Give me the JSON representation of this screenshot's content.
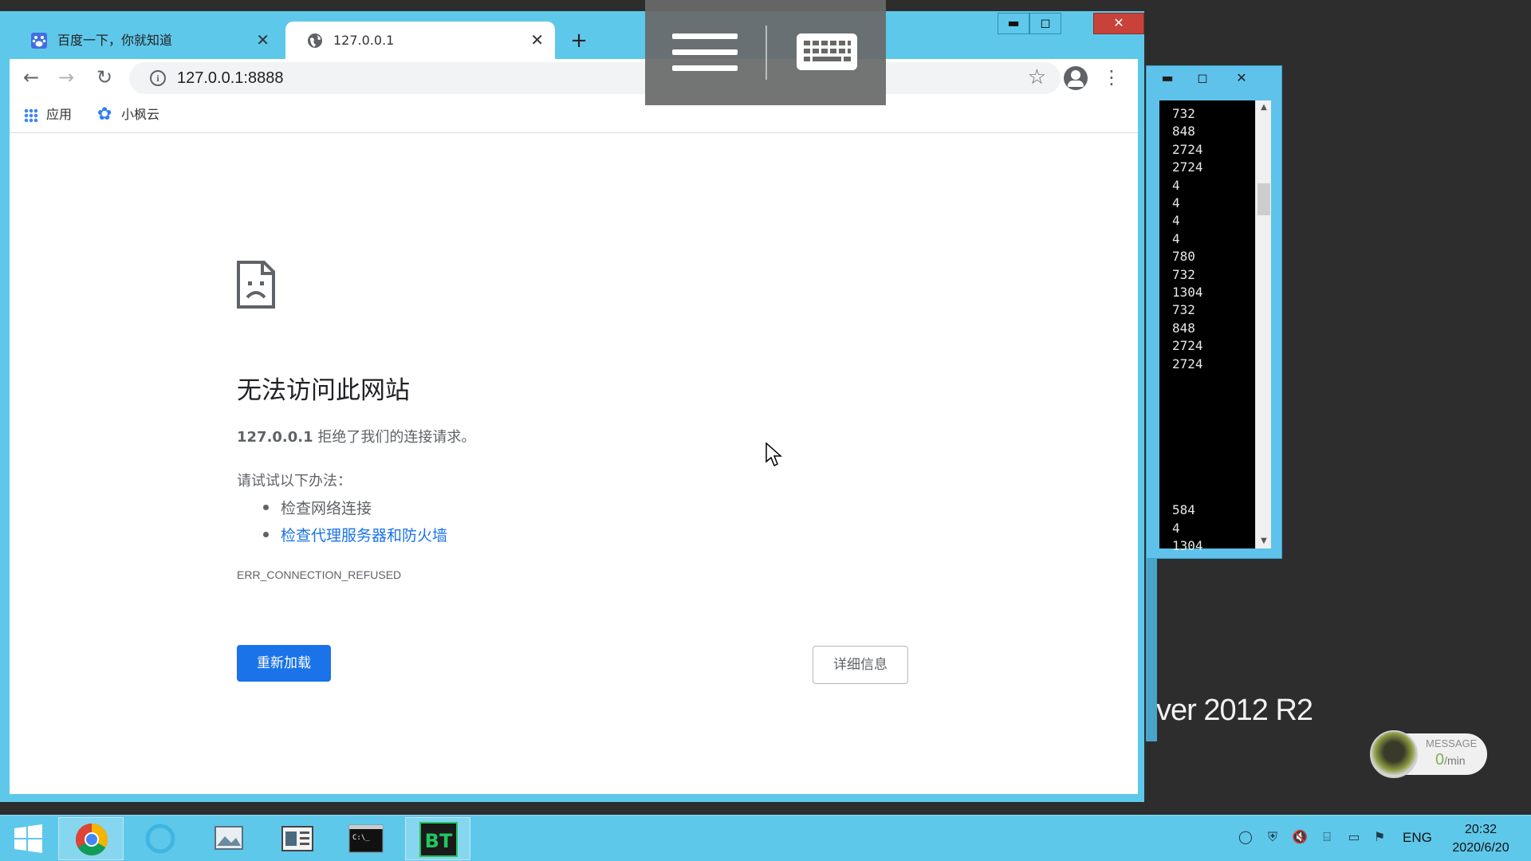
{
  "browser": {
    "tabs": [
      {
        "title": "百度一下，你就知道",
        "active": false
      },
      {
        "title": "127.0.0.1",
        "active": true
      }
    ],
    "address": "127.0.0.1:8888",
    "bookmarks": [
      {
        "label": "应用",
        "icon": "apps-grid-icon"
      },
      {
        "label": "小枫云",
        "icon": "xiaofengyun-icon"
      }
    ]
  },
  "error_page": {
    "title": "无法访问此网站",
    "host": "127.0.0.1",
    "message": "拒绝了我们的连接请求。",
    "try_label": "请试试以下办法：",
    "suggestions": [
      "检查网络连接",
      "检查代理服务器和防火墙"
    ],
    "error_code": "ERR_CONNECTION_REFUSED",
    "reload_label": "重新加载",
    "details_label": "详细信息"
  },
  "console": {
    "lines_top": [
      "732",
      "848",
      "2724",
      "2724",
      "4",
      "4",
      "4",
      "4",
      "780",
      "732",
      "1304",
      "732",
      "848",
      "2724",
      "2724"
    ],
    "lines_bottom": [
      "584",
      "4",
      "1304"
    ]
  },
  "desktop": {
    "os_label": "ver 2012 R2",
    "message_widget": {
      "title": "MESSAGE",
      "count": "0",
      "unit": "/min"
    }
  },
  "taskbar": {
    "apps": [
      "start",
      "chrome",
      "loading",
      "photo-viewer",
      "reader",
      "cmd",
      "bt-panel"
    ],
    "language": "ENG",
    "time": "20:32",
    "date": "2020/6/20"
  },
  "colors": {
    "accent": "#1a73e8",
    "window_frame": "#5ec8ea",
    "close_button": "#c8423a"
  }
}
